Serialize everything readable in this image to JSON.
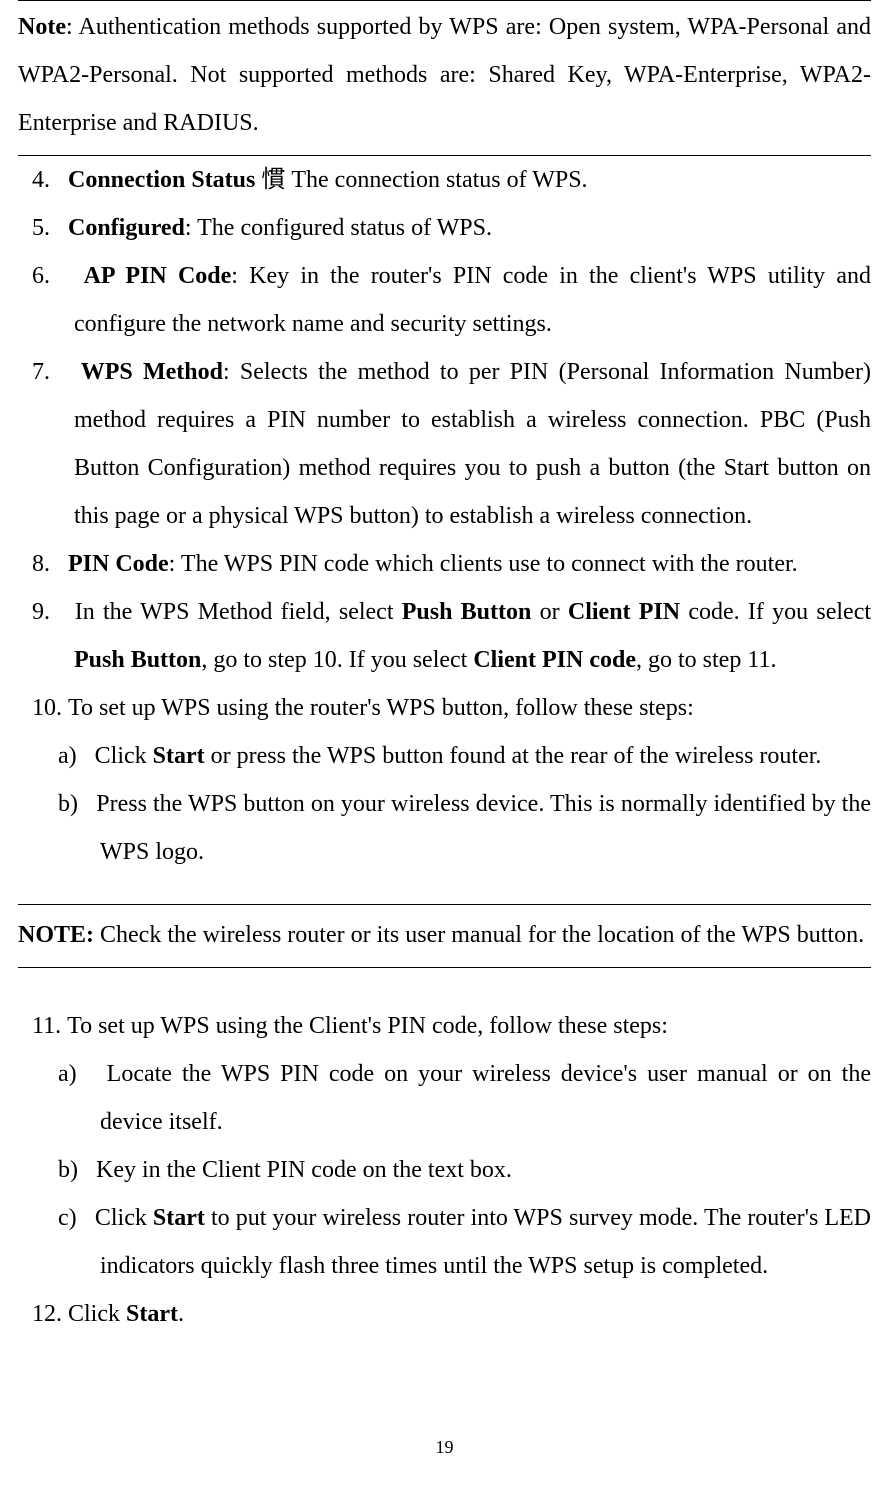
{
  "note1_label": "Note",
  "note1_text": ": Authentication methods supported by WPS are: Open system, WPA-Personal and WPA2-Personal. Not supported methods are: Shared Key, WPA-Enterprise, WPA2-Enterprise and RADIUS.",
  "items": {
    "i4_num": "4.",
    "i4_label": "Connection Status",
    "i4_text": " 慣 The connection status of WPS.",
    "i5_num": "5.",
    "i5_label": "Configured",
    "i5_text": ": The configured status of WPS.",
    "i6_num": "6.",
    "i6_label": "AP PIN Code",
    "i6_text": ": Key in the router's PIN code in the client's WPS utility and configure the network name and security settings.",
    "i7_num": "7.",
    "i7_label": "WPS Method",
    "i7_text": ": Selects the method to per PIN (Personal Information Number) method requires a PIN number to establish a wireless connection. PBC (Push Button Configuration) method requires you to push a button (the Start button on this page or a physical WPS button) to establish a wireless connection.",
    "i8_num": "8.",
    "i8_label": "PIN Code",
    "i8_text": ": The WPS PIN code which clients use to connect with the router.",
    "i9_num": "9.",
    "i9_pre": "In the WPS Method field, select ",
    "i9_b1": "Push Button",
    "i9_mid1": " or ",
    "i9_b2": "Client PIN",
    "i9_mid2": " code. If you select ",
    "i9_b3": "Push Button",
    "i9_mid3": ", go to step 10. If you select ",
    "i9_b4": "Client PIN code",
    "i9_mid4": ", go to step 11.",
    "i10_num": "10.",
    "i10_text": "To set up WPS using the router's WPS button, follow these steps:",
    "i10a_num": "a)",
    "i10a_pre": "Click ",
    "i10a_b": "Start",
    "i10a_post": " or press the WPS button found at the rear of the wireless router.",
    "i10b_num": "b)",
    "i10b_text": "  Press the WPS button on your wireless device. This is normally identified by the WPS logo.",
    "i11_num": "11.",
    "i11_text": "To set up WPS using the Client's PIN code, follow these steps:",
    "i11a_num": "a)",
    "i11a_text": "Locate the WPS PIN code on your wireless device's user manual or on the device itself.",
    "i11b_num": "b)",
    "i11b_text": "Key in the Client PIN code on the text box.",
    "i11c_num": "c)",
    "i11c_pre": "Click ",
    "i11c_b": "Start",
    "i11c_post": " to put your wireless router into WPS survey mode. The router's LED indicators quickly flash three times until the WPS setup is completed.",
    "i12_num": "12.",
    "i12_pre": "Click ",
    "i12_b": "Start",
    "i12_post": "."
  },
  "note2_label": "NOTE:",
  "note2_text": " Check the wireless router or its user manual for the location of the WPS button.",
  "page_number": "19"
}
